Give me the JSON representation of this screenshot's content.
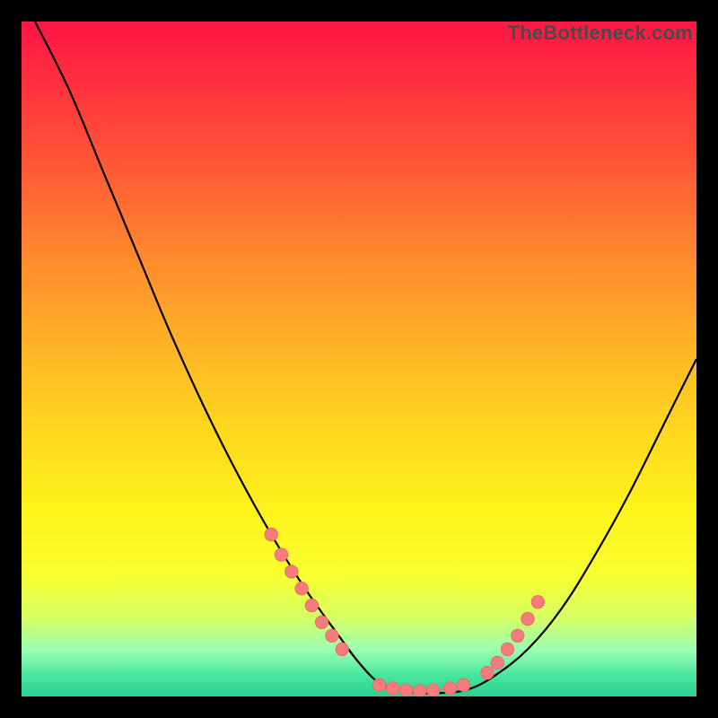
{
  "brand": "TheBottleneck.com",
  "colors": {
    "frame": "#000000",
    "curve_stroke": "#000000",
    "marker_fill": "#f47c7c",
    "marker_stroke": "#ef6a6a"
  },
  "chart_data": {
    "type": "line",
    "title": "",
    "xlabel": "",
    "ylabel": "",
    "xlim": [
      0,
      100
    ],
    "ylim": [
      0,
      100
    ],
    "grid": false,
    "series": [
      {
        "name": "bottleneck-curve",
        "x": [
          2,
          7,
          12,
          17,
          22,
          27,
          32,
          37,
          42,
          47,
          50,
          53,
          56,
          59,
          62,
          66,
          70,
          75,
          80,
          85,
          90,
          95,
          100
        ],
        "y": [
          100,
          90,
          78,
          66,
          54,
          43,
          33,
          24,
          16,
          9,
          5,
          2,
          1,
          0.5,
          0.5,
          1,
          3,
          7,
          13,
          21,
          30,
          40,
          50
        ]
      }
    ],
    "markers_left": [
      {
        "x": 37,
        "y": 24
      },
      {
        "x": 38.5,
        "y": 21
      },
      {
        "x": 40,
        "y": 18.5
      },
      {
        "x": 41.5,
        "y": 16
      },
      {
        "x": 43,
        "y": 13.5
      },
      {
        "x": 44.5,
        "y": 11
      },
      {
        "x": 46,
        "y": 9
      },
      {
        "x": 47.5,
        "y": 7
      }
    ],
    "markers_floor": [
      {
        "x": 53,
        "y": 1.7
      },
      {
        "x": 55,
        "y": 1.2
      },
      {
        "x": 57,
        "y": 0.9
      },
      {
        "x": 59,
        "y": 0.8
      },
      {
        "x": 61,
        "y": 0.9
      },
      {
        "x": 63.5,
        "y": 1.2
      },
      {
        "x": 65.5,
        "y": 1.7
      }
    ],
    "markers_right": [
      {
        "x": 69,
        "y": 3.5
      },
      {
        "x": 70.5,
        "y": 5
      },
      {
        "x": 72,
        "y": 7
      },
      {
        "x": 73.5,
        "y": 9
      },
      {
        "x": 75,
        "y": 11.5
      },
      {
        "x": 76.5,
        "y": 14
      }
    ]
  }
}
